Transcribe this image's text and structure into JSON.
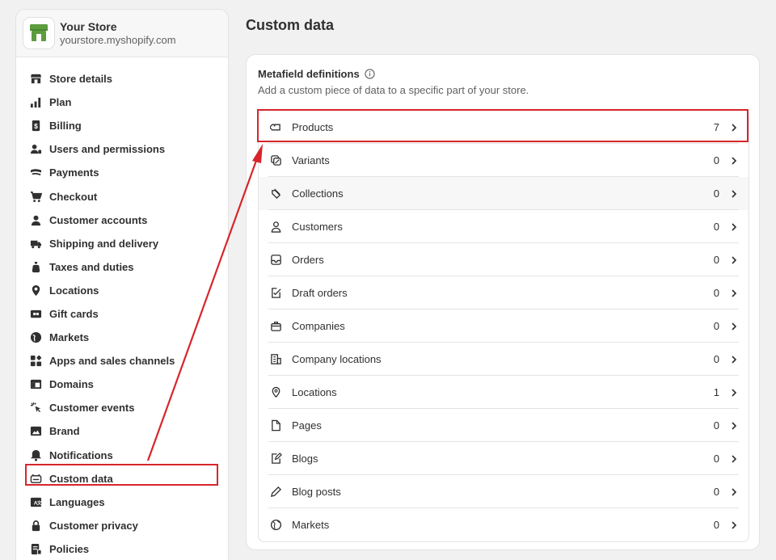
{
  "store": {
    "name": "Your Store",
    "url": "yourstore.myshopify.com"
  },
  "nav": [
    {
      "label": "Store details",
      "icon": "store-icon"
    },
    {
      "label": "Plan",
      "icon": "plan-icon"
    },
    {
      "label": "Billing",
      "icon": "billing-icon"
    },
    {
      "label": "Users and permissions",
      "icon": "users-icon"
    },
    {
      "label": "Payments",
      "icon": "payments-icon"
    },
    {
      "label": "Checkout",
      "icon": "cart-icon"
    },
    {
      "label": "Customer accounts",
      "icon": "person-icon"
    },
    {
      "label": "Shipping and delivery",
      "icon": "truck-icon"
    },
    {
      "label": "Taxes and duties",
      "icon": "tax-icon"
    },
    {
      "label": "Locations",
      "icon": "location-icon"
    },
    {
      "label": "Gift cards",
      "icon": "gift-card-icon"
    },
    {
      "label": "Markets",
      "icon": "globe-icon"
    },
    {
      "label": "Apps and sales channels",
      "icon": "apps-icon"
    },
    {
      "label": "Domains",
      "icon": "domains-icon"
    },
    {
      "label": "Customer events",
      "icon": "cursor-icon"
    },
    {
      "label": "Brand",
      "icon": "brand-icon"
    },
    {
      "label": "Notifications",
      "icon": "bell-icon"
    },
    {
      "label": "Custom data",
      "icon": "custom-data-icon"
    },
    {
      "label": "Languages",
      "icon": "language-icon"
    },
    {
      "label": "Customer privacy",
      "icon": "lock-icon"
    },
    {
      "label": "Policies",
      "icon": "policies-icon"
    }
  ],
  "page_title": "Custom data",
  "card": {
    "title": "Metafield definitions",
    "subtitle": "Add a custom piece of data to a specific part of your store."
  },
  "definitions": [
    {
      "label": "Products",
      "count": "7",
      "icon": "tag-icon"
    },
    {
      "label": "Variants",
      "count": "0",
      "icon": "variants-icon"
    },
    {
      "label": "Collections",
      "count": "0",
      "icon": "collections-icon"
    },
    {
      "label": "Customers",
      "count": "0",
      "icon": "person-outline-icon"
    },
    {
      "label": "Orders",
      "count": "0",
      "icon": "inbox-icon"
    },
    {
      "label": "Draft orders",
      "count": "0",
      "icon": "draft-order-icon"
    },
    {
      "label": "Companies",
      "count": "0",
      "icon": "companies-icon"
    },
    {
      "label": "Company locations",
      "count": "0",
      "icon": "building-icon"
    },
    {
      "label": "Locations",
      "count": "1",
      "icon": "location-pin-icon"
    },
    {
      "label": "Pages",
      "count": "0",
      "icon": "page-icon"
    },
    {
      "label": "Blogs",
      "count": "0",
      "icon": "blog-icon"
    },
    {
      "label": "Blog posts",
      "count": "0",
      "icon": "pencil-icon"
    },
    {
      "label": "Markets",
      "count": "0",
      "icon": "globe-outline-icon"
    }
  ],
  "colors": {
    "highlight": "#d6262b",
    "store_logo": "#5c9d3f",
    "text": "#303030"
  }
}
